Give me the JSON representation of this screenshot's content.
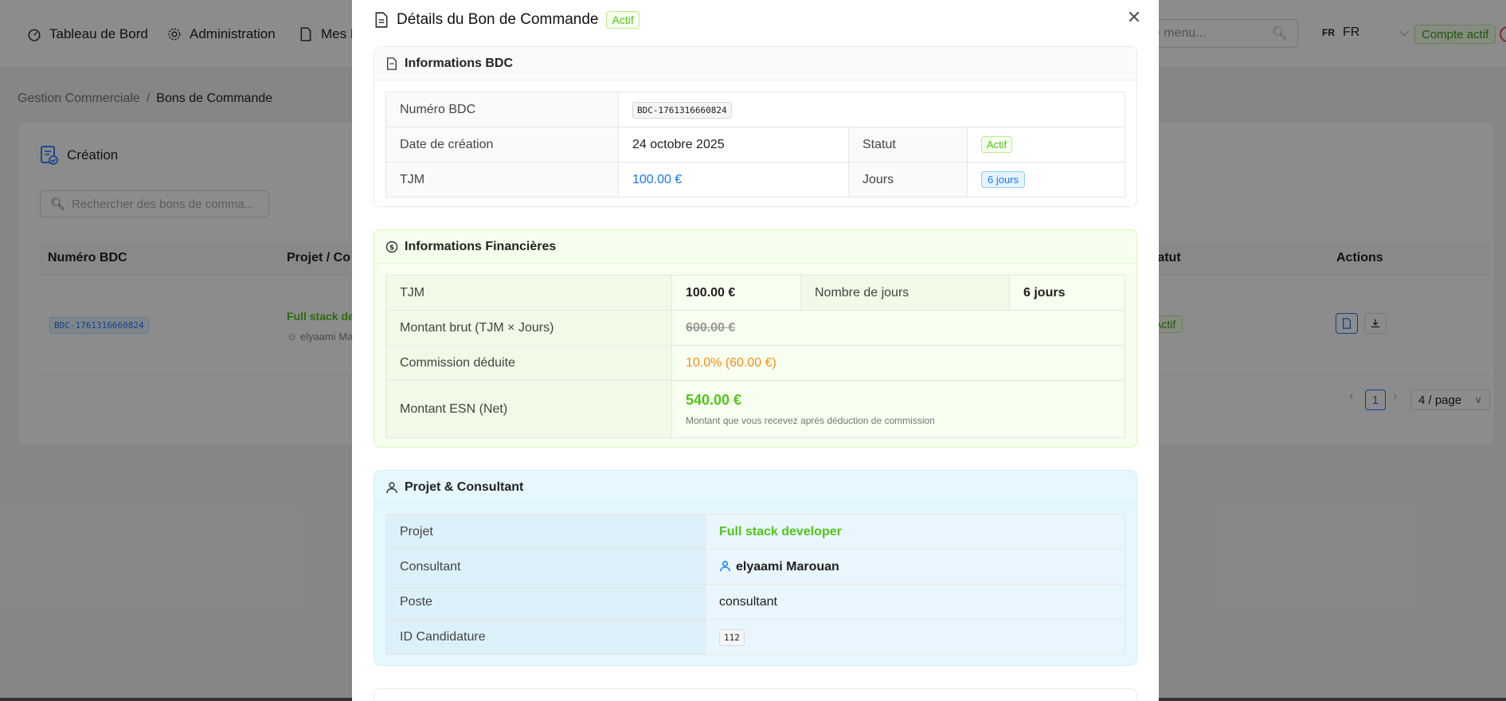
{
  "topnav": {
    "items": [
      {
        "label": "Tableau de Bord",
        "icon": "dashboard-icon"
      },
      {
        "label": "Administration",
        "icon": "gear-icon"
      },
      {
        "label": "Mes D",
        "icon": "file-icon"
      }
    ],
    "search_placeholder": "ns le menu...",
    "lang_flag": "FR",
    "lang_label": "FR",
    "account_status": "Compte actif"
  },
  "breadcrumb": {
    "parent": "Gestion Commerciale",
    "current": "Bons de Commande"
  },
  "list": {
    "card_title": "Création",
    "search_placeholder": "Rechercher des bons de comma...",
    "columns": [
      "Numéro BDC",
      "Projet / Co",
      "tatut",
      "Actions"
    ],
    "rows": [
      {
        "numero": "BDC-1761316660824",
        "projet": "Full stack dev",
        "consultant": "elyaami Mar",
        "statut": "Actif"
      }
    ],
    "pagination": {
      "current_page": "1",
      "page_size": "4 / page"
    }
  },
  "modal": {
    "title": "Détails du Bon de Commande",
    "status_tag": "Actif",
    "bdc_section": {
      "title": "Informations BDC",
      "numero_label": "Numéro BDC",
      "numero_value": "BDC-1761316660824",
      "date_label": "Date de création",
      "date_value": "24 octobre 2025",
      "statut_label": "Statut",
      "statut_value": "Actif",
      "tjm_label": "TJM",
      "tjm_value": "100.00 €",
      "jours_label": "Jours",
      "jours_value": "6 jours"
    },
    "finance_section": {
      "title": "Informations Financières",
      "tjm_label": "TJM",
      "tjm_value": "100.00 €",
      "nb_jours_label": "Nombre de jours",
      "nb_jours_value": "6 jours",
      "brut_label": "Montant brut (TJM × Jours)",
      "brut_value": "600.00 €",
      "commission_label": "Commission déduite",
      "commission_value": "10.0% (60.00 €)",
      "net_label": "Montant ESN (Net)",
      "net_value": "540.00 €",
      "net_note": "Montant que vous recevez après déduction de commission"
    },
    "projet_section": {
      "title": "Projet & Consultant",
      "projet_label": "Projet",
      "projet_value": "Full stack developer",
      "consultant_label": "Consultant",
      "consultant_value": "elyaami Marouan",
      "poste_label": "Poste",
      "poste_value": "consultant",
      "candidature_label": "ID Candidature",
      "candidature_value": "112"
    }
  },
  "colors": {
    "primary": "#1677ff",
    "success": "#52c41a",
    "warning": "#fa8c16",
    "finance_bg": "#f6ffed",
    "project_bg": "#e6f7ff"
  }
}
